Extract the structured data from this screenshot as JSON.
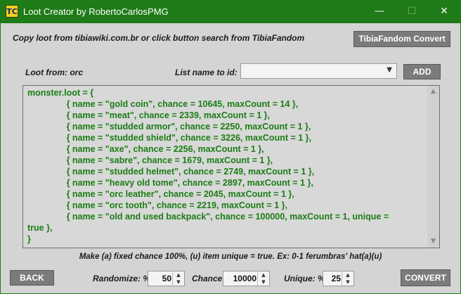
{
  "window": {
    "title": "Loot Creator by RobertoCarlosPMG",
    "app_icon_glyph": "TC",
    "minimize_glyph": "—",
    "maximize_glyph": "☐",
    "close_glyph": "✕"
  },
  "header": {
    "instruction": "Copy loot from tibiawiki.com.br or click button search from TibiaFandom",
    "fandom_button_label": "TibiaFandom Convert"
  },
  "loot_row": {
    "loot_from_label": "Loot from: orc",
    "list_name_label": "List name to id:",
    "select_value": "",
    "add_label": "ADD"
  },
  "editor": {
    "lines": [
      "monster.loot = {",
      "                { name = \"gold coin\", chance = 10645, maxCount = 14 },",
      "                { name = \"meat\", chance = 2339, maxCount = 1 },",
      "                { name = \"studded armor\", chance = 2250, maxCount = 1 },",
      "                { name = \"studded shield\", chance = 3226, maxCount = 1 },",
      "                { name = \"axe\", chance = 2256, maxCount = 1 },",
      "                { name = \"sabre\", chance = 1679, maxCount = 1 },",
      "                { name = \"studded helmet\", chance = 2749, maxCount = 1 },",
      "                { name = \"heavy old tome\", chance = 2897, maxCount = 1 },",
      "                { name = \"orc leather\", chance = 2045, maxCount = 1 },",
      "                { name = \"orc tooth\", chance = 2219, maxCount = 1 },",
      "                { name = \"old and used backpack\", chance = 100000, maxCount = 1, unique =",
      "true },",
      "}"
    ]
  },
  "note": "Make (a) fixed chance 100%, (u) item unique = true. Ex: 0-1 ferumbras' hat(a)(u)",
  "footer": {
    "back_label": "BACK",
    "randomize_label": "Randomize: %",
    "randomize_value": "50",
    "chance_label": "Chance:",
    "chance_value": "10000",
    "unique_label": "Unique: %",
    "unique_value": "25",
    "convert_label": "CONVERT"
  },
  "colors": {
    "titlebar": "#1e7b17",
    "code_text": "#1b7d14",
    "button_bg": "#7b7b7b",
    "window_bg": "#d4d4d4"
  }
}
